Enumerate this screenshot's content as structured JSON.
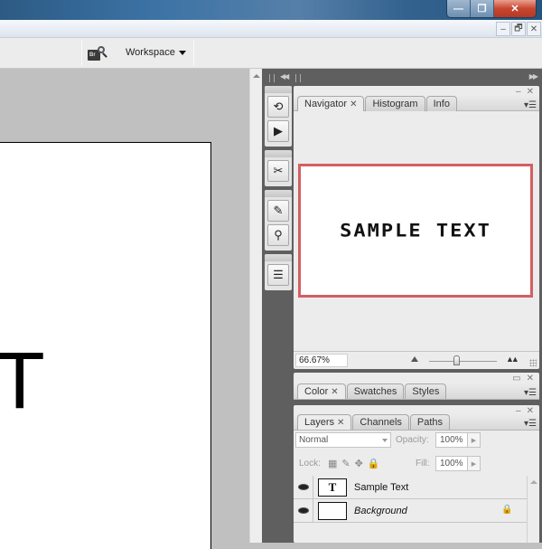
{
  "window": {
    "os_controls": {
      "minimize": "—",
      "restore": "❐",
      "close": "✕"
    },
    "doc_controls": {
      "minimize": "–",
      "restore": "🗗",
      "close": "✕"
    }
  },
  "options_bar": {
    "bridge_label": "Br",
    "workspace_label": "Workspace"
  },
  "canvas": {
    "visible_text": "XT"
  },
  "tool_strip": {
    "groups": [
      {
        "tools": [
          "history-icon",
          "actions-icon"
        ]
      },
      {
        "tools": [
          "tool-presets-icon"
        ]
      },
      {
        "tools": [
          "brushes-icon",
          "clone-source-icon"
        ]
      },
      {
        "tools": [
          "layer-comps-icon"
        ]
      }
    ]
  },
  "navigator_panel": {
    "tabs": [
      {
        "label": "Navigator",
        "active": true,
        "closable": true
      },
      {
        "label": "Histogram",
        "active": false
      },
      {
        "label": "Info",
        "active": false
      }
    ],
    "preview_text": "SAMPLE TEXT",
    "view_box_color": "#d45f61",
    "zoom_value": "66.67%",
    "zoom_slider_fraction": 0.4
  },
  "color_panel": {
    "tabs": [
      {
        "label": "Color",
        "active": true,
        "closable": true
      },
      {
        "label": "Swatches",
        "active": false
      },
      {
        "label": "Styles",
        "active": false
      }
    ]
  },
  "layers_panel": {
    "tabs": [
      {
        "label": "Layers",
        "active": true,
        "closable": true
      },
      {
        "label": "Channels",
        "active": false
      },
      {
        "label": "Paths",
        "active": false
      }
    ],
    "blend_mode": "Normal",
    "opacity_label": "Opacity:",
    "opacity_value": "100%",
    "lock_label": "Lock:",
    "fill_label": "Fill:",
    "fill_value": "100%",
    "layers": [
      {
        "name": "Sample Text",
        "thumb": "T",
        "visible": true,
        "locked": false,
        "italic": false
      },
      {
        "name": "Background",
        "thumb": "",
        "visible": true,
        "locked": true,
        "italic": true
      }
    ]
  }
}
